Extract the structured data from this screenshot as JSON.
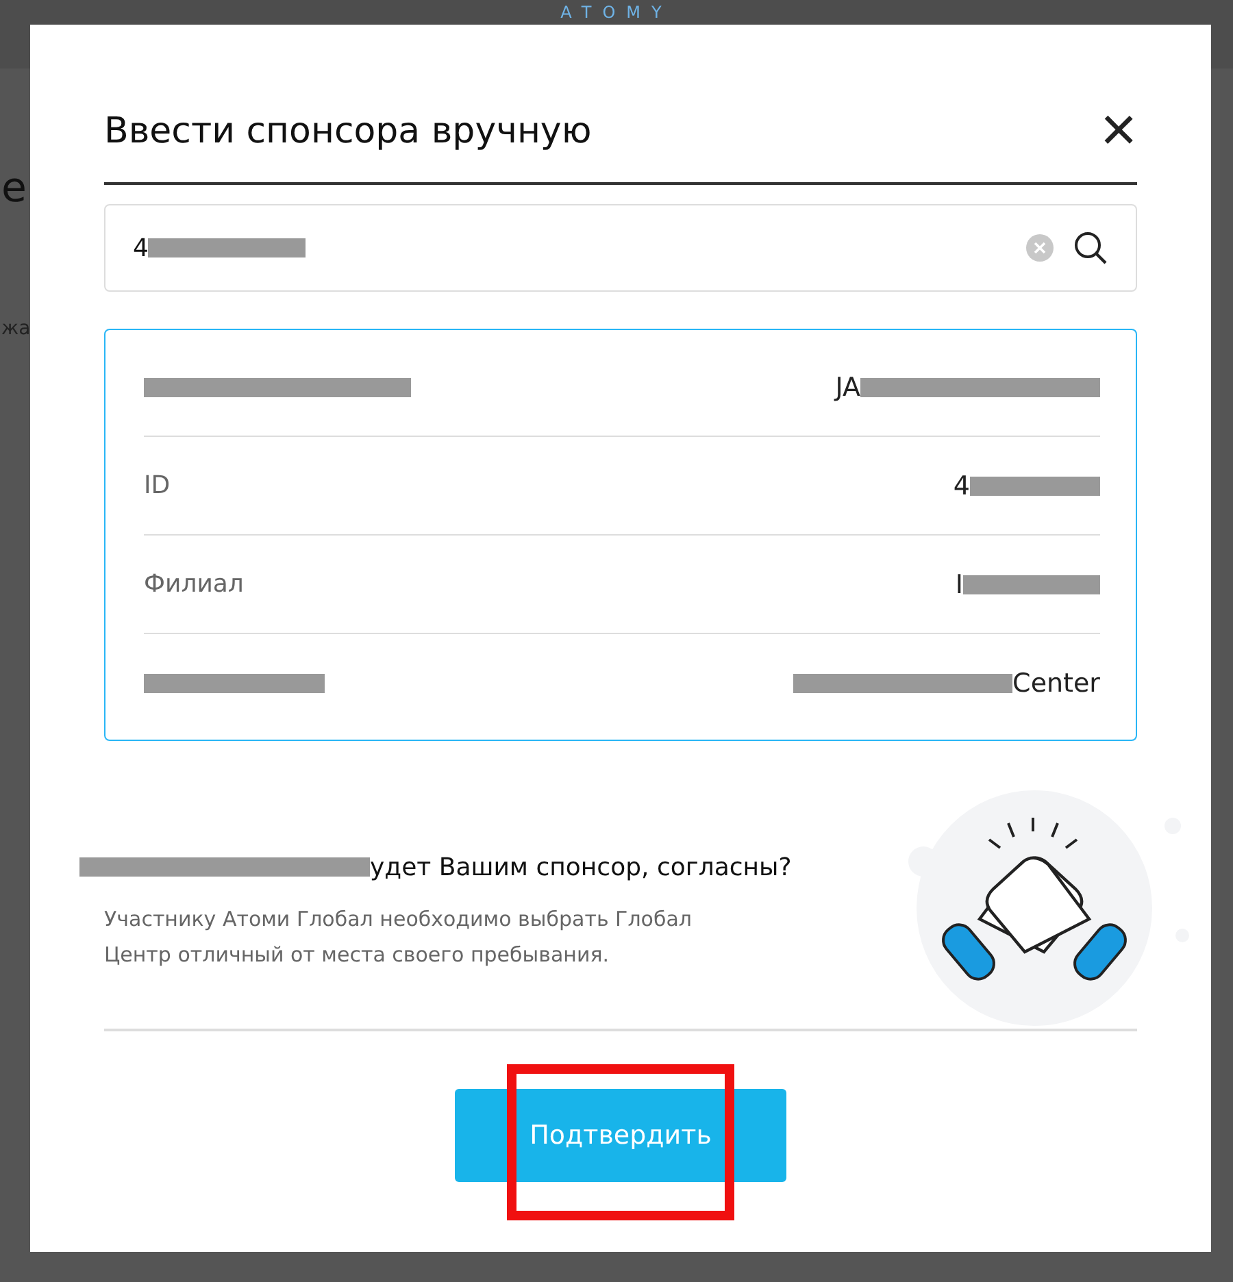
{
  "background": {
    "logo": "ATOMY",
    "heading_fragment": "е",
    "tab_fragment": "жа"
  },
  "dialog": {
    "title": "Ввести спонсора вручную",
    "close": "×",
    "search": {
      "value": "4"
    },
    "sponsor_rows": [
      {
        "label": "",
        "value": "JA"
      },
      {
        "label": "ID",
        "value": "4"
      },
      {
        "label": "Филиал",
        "value": "I"
      },
      {
        "label": "",
        "value": "Center"
      }
    ],
    "question": "удет Вашим спонсор, согласны?",
    "note": "Участнику Атоми Глобал необходимо выбрать Глобал Центр отличный от места своего пребывания.",
    "confirm_button": "Подтвердить"
  }
}
